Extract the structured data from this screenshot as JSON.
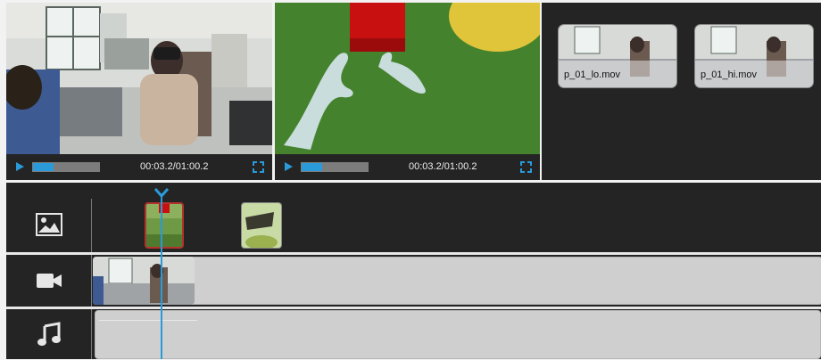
{
  "players": [
    {
      "name": "camera-player",
      "timecode": "00:03.2/01:00.2",
      "progress": 0.3
    },
    {
      "name": "vr-player",
      "timecode": "00:03.2/01:00.2",
      "progress": 0.3
    }
  ],
  "media_bin": {
    "clips": [
      {
        "label": "p_01_lo.mov"
      },
      {
        "label": "p_01_hi.mov"
      }
    ]
  },
  "timeline": {
    "tracks": [
      {
        "icon": "image-icon"
      },
      {
        "icon": "video-camera-icon"
      },
      {
        "icon": "music-note-icon"
      }
    ]
  },
  "colors": {
    "accent": "#2a9bd8",
    "panel": "#242424",
    "selected_border": "#b3322c"
  }
}
